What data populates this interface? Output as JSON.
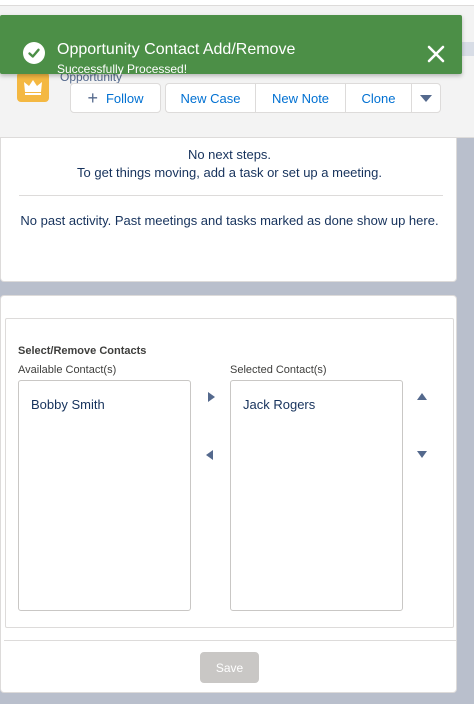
{
  "toast": {
    "title": "Opportunity Contact Add/Remove",
    "message": "Successfully Processed!"
  },
  "record": {
    "type_label": "Opportunity",
    "actions": {
      "follow": "Follow",
      "new_case": "New Case",
      "new_note": "New Note",
      "clone": "Clone"
    }
  },
  "activity": {
    "next_steps_line1": "No next steps.",
    "next_steps_line2": "To get things moving, add a task or set up a meeting.",
    "past_activity": "No past activity. Past meetings and tasks marked as done show up here."
  },
  "contacts": {
    "section_title": "Select/Remove Contacts",
    "available_label": "Available Contact(s)",
    "selected_label": "Selected Contact(s)",
    "available": [
      "Bobby Smith"
    ],
    "selected": [
      "Jack Rogers"
    ],
    "save_label": "Save"
  },
  "colors": {
    "toast_bg": "#4c8f47",
    "brand_blue": "#0070d2",
    "record_icon": "#f4b842",
    "backdrop": "#b9bfcc"
  }
}
